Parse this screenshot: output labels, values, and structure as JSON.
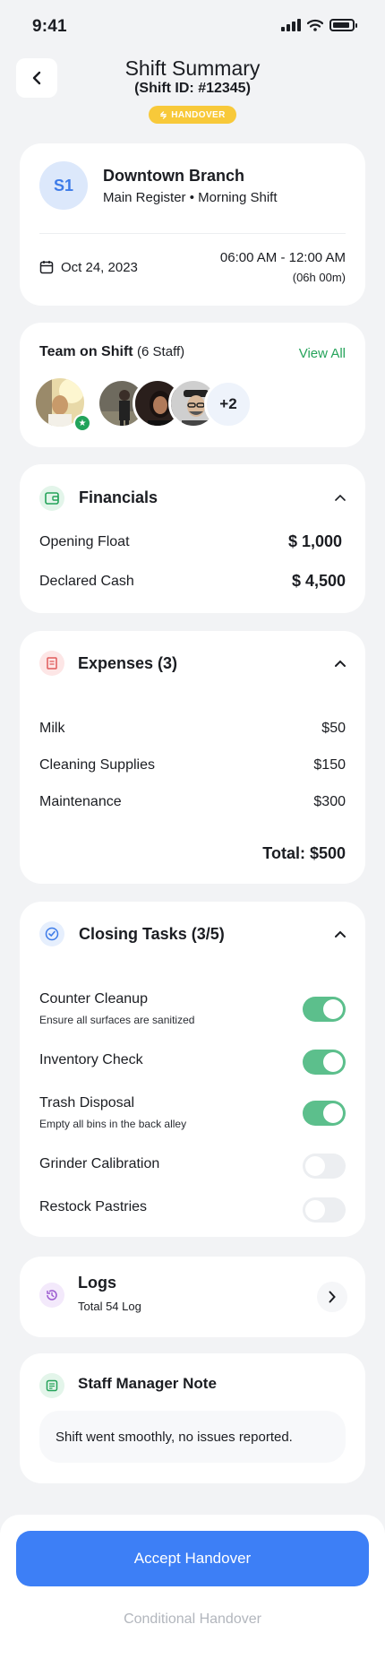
{
  "status_bar": {
    "time": "9:41"
  },
  "header": {
    "title": "Shift Summary",
    "subtitle": "(Shift ID: #12345)",
    "badge": "HANDOVER"
  },
  "branch": {
    "initials": "S1",
    "name": "Downtown Branch",
    "detail": "Main Register • Morning Shift",
    "date": "Oct 24, 2023",
    "time_range": "06:00 AM - 12:00 AM",
    "duration": "(06h 00m)"
  },
  "team": {
    "title": "Team on Shift",
    "count": "(6 Staff)",
    "view_all": "View All",
    "more": "+2"
  },
  "financials": {
    "title": "Financials",
    "rows": [
      {
        "label": "Opening Float",
        "value": "$ 1,000"
      },
      {
        "label": "Declared Cash",
        "value": "$ 4,500"
      }
    ]
  },
  "expenses": {
    "title": "Expenses (3)",
    "items": [
      {
        "label": "Milk",
        "value": "$50"
      },
      {
        "label": "Cleaning Supplies",
        "value": "$150"
      },
      {
        "label": "Maintenance",
        "value": "$300"
      }
    ],
    "total": "Total: $500"
  },
  "tasks": {
    "title": "Closing Tasks (3/5)",
    "items": [
      {
        "title": "Counter Cleanup",
        "sub": "Ensure all surfaces are sanitized",
        "done": true
      },
      {
        "title": "Inventory Check",
        "sub": "",
        "done": true
      },
      {
        "title": "Trash Disposal",
        "sub": "Empty all bins in the back alley",
        "done": true
      },
      {
        "title": "Grinder Calibration",
        "sub": "",
        "done": false
      },
      {
        "title": "Restock Pastries",
        "sub": "",
        "done": false
      }
    ]
  },
  "logs": {
    "title": "Logs",
    "sub": "Total 54 Log"
  },
  "note": {
    "title": "Staff Manager Note",
    "text": "Shift went smoothly, no issues reported."
  },
  "actions": {
    "accept": "Accept Handover",
    "conditional": "Conditional Handover"
  },
  "colors": {
    "accent": "#3d7ff6",
    "success": "#5cbf8c",
    "badge": "#f8c93a",
    "danger": "#e05a5a"
  }
}
